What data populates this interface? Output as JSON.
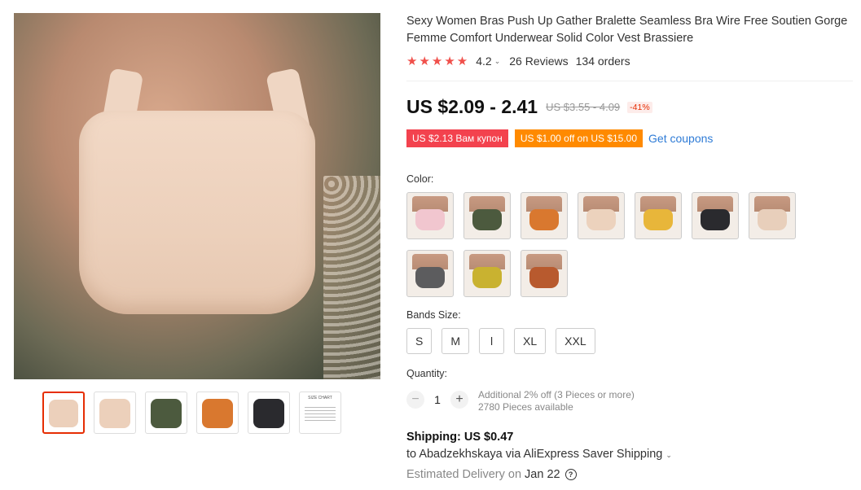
{
  "product": {
    "title": "Sexy Women Bras Push Up Gather Bralette Seamless Bra Wire Free Soutien Gorge Femme Comfort Underwear Solid Color Vest Brassiere",
    "rating": "4.2",
    "stars": "★★★★★",
    "reviews": "26 Reviews",
    "orders": "134 orders"
  },
  "price": {
    "current": "US $2.09 - 2.41",
    "original": "US $3.55 - 4.09",
    "discount": "-41%"
  },
  "coupons": {
    "coupon1": "US $2.13 Вам купон",
    "coupon2": "US $1.00 off on US $15.00",
    "get_coupons": "Get coupons"
  },
  "color": {
    "label": "Color:",
    "swatches": [
      {
        "cup": "#f1c6cf"
      },
      {
        "cup": "#4c5a3e"
      },
      {
        "cup": "#d9782f"
      },
      {
        "cup": "#ecd2bd"
      },
      {
        "cup": "#e8b63a"
      },
      {
        "cup": "#2a2a2e"
      },
      {
        "cup": "#e8cfbb"
      },
      {
        "cup": "#5c5c5e"
      },
      {
        "cup": "#c9b230"
      },
      {
        "cup": "#b85a2e"
      }
    ]
  },
  "bands": {
    "label": "Bands Size:",
    "sizes": [
      "S",
      "M",
      "l",
      "XL",
      "XXL"
    ]
  },
  "quantity": {
    "label": "Quantity:",
    "value": "1",
    "minus": "−",
    "plus": "+",
    "offer": "Additional 2% off (3 Pieces or more)",
    "available": "2780 Pieces available"
  },
  "shipping": {
    "cost": "Shipping: US $0.47",
    "to": "to Abadzekhskaya via AliExpress Saver Shipping",
    "delivery_label": "Estimated Delivery on",
    "delivery_date": "Jan 22"
  },
  "gallery": {
    "thumbs": [
      "#ecd0bb",
      "#ecd0bb",
      "#4c5a3e",
      "#d9782f",
      "#2a2a2e"
    ],
    "size_chart_caption": "SIZE CHART"
  }
}
